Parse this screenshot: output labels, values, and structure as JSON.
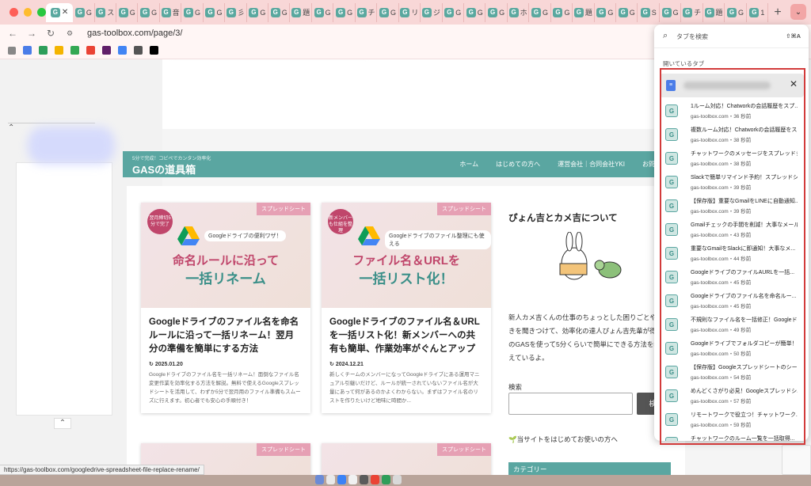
{
  "browser": {
    "tabs": [
      "G",
      "G",
      "ス",
      "G",
      "G",
      "音",
      "G",
      "G",
      "彡",
      "G",
      "G",
      "題",
      "G",
      "G",
      "チ",
      "G",
      "リ",
      "ジ",
      "G",
      "G",
      "G",
      "ホ",
      "G",
      "G",
      "題",
      "G",
      "G",
      "S",
      "G",
      "チ",
      "題",
      "G",
      "1"
    ],
    "new_tab_label": "+",
    "url": "gas-toolbox.com/page/3/",
    "status_url": "https://gas-toolbox.com/googledrive-spreadsheet-file-replace-rename/"
  },
  "site": {
    "tagline": "5分で完成！コピペでカンタン効率化",
    "logo": "GASの道具箱",
    "nav": [
      "ホーム",
      "はじめての方へ",
      "運営会社｜合同会社YKI",
      "お問い合わせ"
    ],
    "articles": [
      {
        "category": "スプレッドシート",
        "badge": "翌月締切5分で完了",
        "thumb_subtitle": "Googleドライブの便利ワザ！",
        "thumb_line1": "命名ルールに沿って",
        "thumb_line2": "一括リネーム",
        "title": "Googleドライブのファイル名を命名ルールに沿って一括リネーム！翌月分の準備を簡単にする方法",
        "date": "2025.01.20",
        "excerpt": "Googleドライブのファイル名を一括リネーム！面倒なファイル名変更作業を効率化する方法を解説。無料で使えるGoogleスプレッドシートを活用して、わずか5分で翌月用のファイル準備もスムーズに行えます。初心者でも安心の手順付き！"
      },
      {
        "category": "スプレッドシート",
        "badge": "新メンバーも仕組を整理",
        "thumb_subtitle": "Googleドライブのファイル整理にも使える",
        "thumb_line1": "ファイル名＆URLを",
        "thumb_line2": "一括リスト化！",
        "title": "Googleドライブのファイル名＆URLを一括リスト化！新メンバーへの共有も簡単、作業効率がぐんとアップ",
        "date": "2024.12.21",
        "excerpt": "新しくチームのメンバーになってGoogleドライブにある運用マニュアル引継いだけど、ルールが統一されていないファイル名が大量にあって何があるのかよくわからない。まずはファイル名のリストを作りたいけど地味に時間か..."
      }
    ],
    "more_categories": [
      "スプレッドシート",
      "スプレッドシート"
    ],
    "sidebar": {
      "about_title": "ぴょん吉とカメ吉について",
      "about_text": "新人カメ吉くんの仕事のちょっとした困りごとや呟きを聞きつけて、効率化の達人ぴょん吉先輩が得意のGASを使って5分くらいで簡単にできる方法を教えているよ。",
      "search_label": "検索",
      "search_button": "検",
      "guide_link": "🌱当サイトをはじめてお使いの方へ",
      "category_heading": "カテゴリー"
    }
  },
  "tab_search": {
    "placeholder": "タブを検索",
    "shortcut": "⇧⌘A",
    "heading": "開いているタブ",
    "items": [
      {
        "title": "1ルーム対応！Chatworkの会話履歴をスプ...",
        "sub": "gas-toolbox.com・36 秒前"
      },
      {
        "title": "複数ルーム対応！Chatworkの会話履歴をス...",
        "sub": "gas-toolbox.com・38 秒前"
      },
      {
        "title": "チャットワークのメッセージをスプレッドシ...",
        "sub": "gas-toolbox.com・38 秒前"
      },
      {
        "title": "Slackで簡単リマインド予約！スプレッドシ...",
        "sub": "gas-toolbox.com・39 秒前"
      },
      {
        "title": "【保存版】重要なGmailをLINEに自動通知...",
        "sub": "gas-toolbox.com・39 秒前"
      },
      {
        "title": "Gmailチェックの手間を削減！大事なメール...",
        "sub": "gas-toolbox.com・43 秒前"
      },
      {
        "title": "重要なGmailをSlackに即通知！大事なメ...",
        "sub": "gas-toolbox.com・44 秒前"
      },
      {
        "title": "GoogleドライブのファイルAURLを一括...",
        "sub": "gas-toolbox.com・45 秒前"
      },
      {
        "title": "Googleドライブのファイル名を命名ルー...",
        "sub": "gas-toolbox.com・45 秒前"
      },
      {
        "title": "不規則なファイル名を一括修正！Googleド...",
        "sub": "gas-toolbox.com・49 秒前"
      },
      {
        "title": "Googleドライブでフォルダコピーが簡単！...",
        "sub": "gas-toolbox.com・50 秒前"
      },
      {
        "title": "【保存版】Googleスプレッドシートのシー...",
        "sub": "gas-toolbox.com・54 秒前"
      },
      {
        "title": "めんどくさがり必見！Googleスプレッドシ...",
        "sub": "gas-toolbox.com・57 秒前"
      },
      {
        "title": "リモートワークで役立つ！チャットワーク...",
        "sub": "gas-toolbox.com・59 秒前"
      },
      {
        "title": "チャットワークのルーム一覧を一括取得...",
        "sub": "gas-toolbox.com・1 分前"
      }
    ]
  },
  "colors": {
    "accent": "#5aa6a1",
    "tab_bar": "#f8d7d7",
    "highlight": "#d23b3b",
    "category": "#e6a0b4"
  },
  "icons": [
    "search-icon",
    "close-icon",
    "back-icon",
    "forward-icon",
    "reload-icon",
    "google-drive-icon",
    "docs-icon",
    "tab-search-icon"
  ]
}
